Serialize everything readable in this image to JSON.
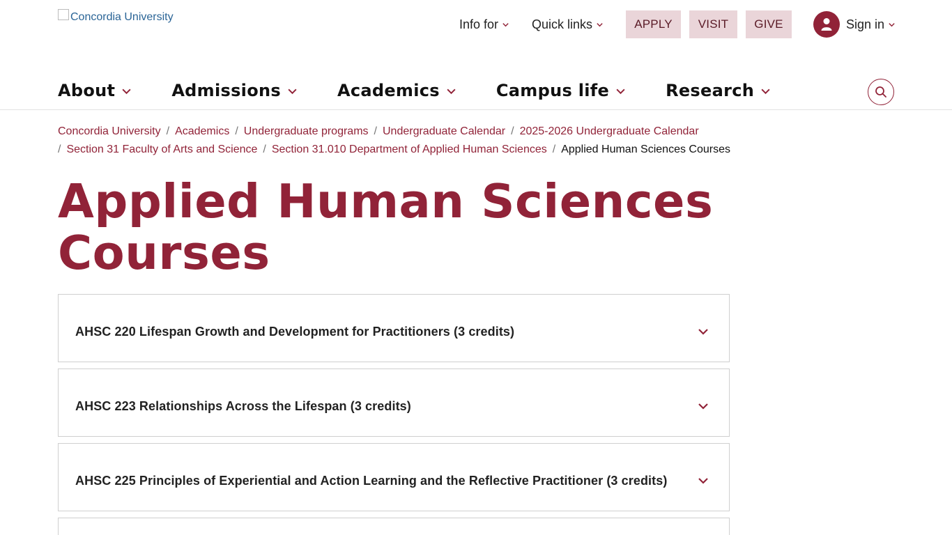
{
  "header": {
    "logo_alt": "Concordia University",
    "utility_links": [
      {
        "label": "Info for"
      },
      {
        "label": "Quick links"
      }
    ],
    "cta_buttons": {
      "apply": "APPLY",
      "visit": "VISIT",
      "give": "GIVE"
    },
    "signin_label": "Sign in"
  },
  "main_nav": {
    "items": [
      {
        "label": "About"
      },
      {
        "label": "Admissions"
      },
      {
        "label": "Academics"
      },
      {
        "label": "Campus life"
      },
      {
        "label": "Research"
      }
    ],
    "search_icon": "search-icon"
  },
  "breadcrumb": {
    "links": [
      "Concordia University",
      "Academics",
      "Undergraduate programs",
      "Undergraduate Calendar",
      "2025-2026 Undergraduate Calendar",
      "Section 31 Faculty of Arts and Science",
      "Section 31.010 Department of Applied Human Sciences"
    ],
    "current": "Applied Human Sciences Courses"
  },
  "page": {
    "title_line1": "Applied Human Sciences",
    "title_line2": "Courses"
  },
  "courses": [
    {
      "title": "AHSC 220 Lifespan Growth and Development for Practitioners (3 credits)"
    },
    {
      "title": "AHSC 223 Relationships Across the Lifespan (3 credits)"
    },
    {
      "title": "AHSC 225 Principles of Experiential and Action Learning and the Reflective Practitioner (3 credits)"
    }
  ],
  "colors": {
    "brand": "#912338",
    "cta_bg": "#ead5d9",
    "border": "#cfcfcf"
  }
}
